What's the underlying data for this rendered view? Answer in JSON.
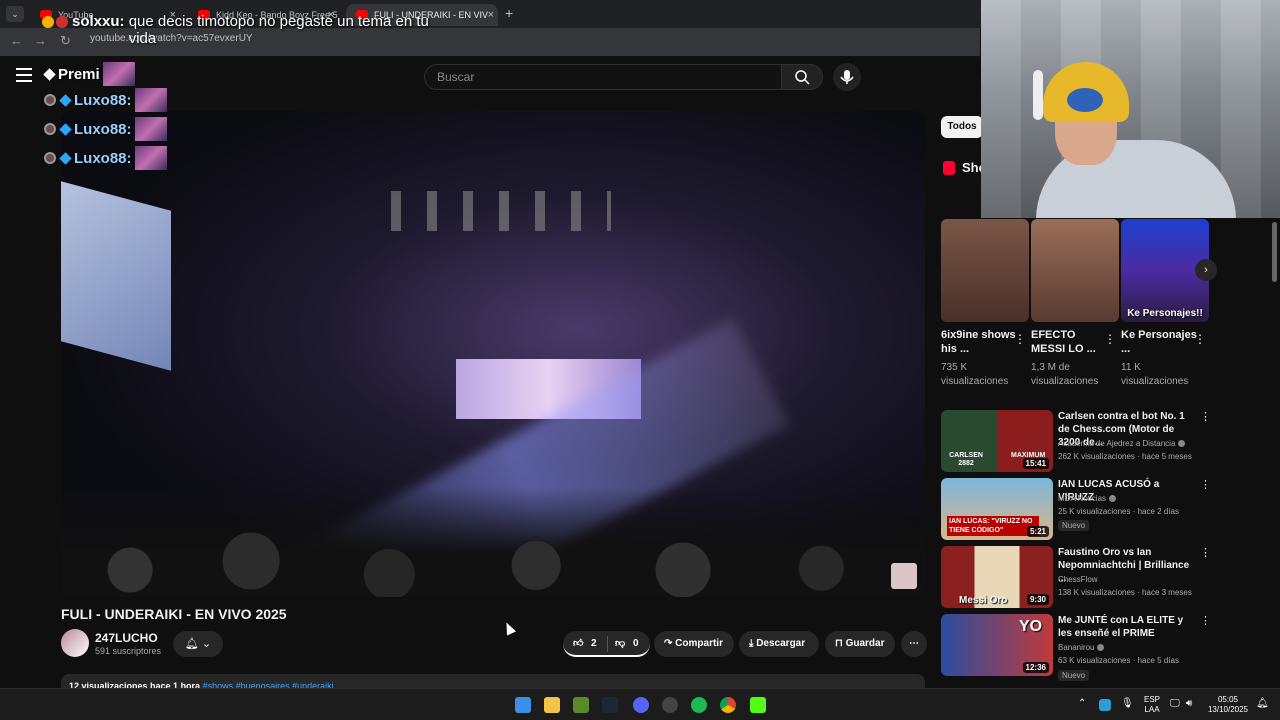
{
  "browser": {
    "tabs": [
      {
        "title": "YouTube"
      },
      {
        "title": "Kidd Keo - Bando Boyz Free 5 |"
      },
      {
        "title": "FULI - UNDERAIKI - EN VIV"
      }
    ],
    "url": "youtube.com/watch?v=ac57evxerUY"
  },
  "overlay_chat": {
    "user": "solxxu:",
    "message": "que decis timotopo no pegaste un tema en tu vida",
    "second_line": "Premi",
    "followers": [
      "Luxo88:",
      "Luxo88:",
      "Luxo88:"
    ]
  },
  "header": {
    "search_placeholder": "Buscar"
  },
  "video": {
    "title": "FULI - UNDERAIKI - EN VIVO 2025",
    "channel": "247LUCHO",
    "subscribers": "591 suscriptores",
    "likes": "2",
    "dislikes": "0",
    "share_label": "Compartir",
    "download_label": "Descargar",
    "save_label": "Guardar",
    "description_stats": "12 visualizaciones  hace 1 hora",
    "description_tags": "#shows #buenosaires #underaiki"
  },
  "sidebar": {
    "chip": "Todos",
    "shorts_label": "Sho",
    "shorts": [
      {
        "title": "6ix9ine shows his ...",
        "views": "735 K visualizaciones",
        "overlay": ""
      },
      {
        "title": "EFECTO MESSI LO ...",
        "views": "1,3 M de visualizaciones",
        "overlay": ""
      },
      {
        "title": "Ke Personajes ...",
        "views": "11 K visualizaciones",
        "overlay": "Ke Personajes!!"
      }
    ],
    "recommendations": [
      {
        "title": "Carlsen contra el bot No. 1 de Chess.com (Motor de 3200 de...",
        "channel": "Academia de Ajedrez a Distancia",
        "meta": "262 K visualizaciones · hace 5 meses",
        "duration": "15:41",
        "badge": "",
        "thumb_text_1": "CARLSEN",
        "thumb_text_2": "2882",
        "thumb_text_3": "MAXIMUM"
      },
      {
        "title": "IAN LUCAS ACUSÓ a VIRUZZ",
        "channel": "MDA Noticias",
        "meta": "25 K visualizaciones · hace 2 días",
        "duration": "5:21",
        "badge": "Nuevo",
        "thumb_text_1": "IAN LUCAS: \"VIRUZZ NO TIENE CÓDIGO\""
      },
      {
        "title": "Faustino Oro vs Ian Nepomniachtchi | Brilliance ...",
        "channel": "ChessFlow",
        "meta": "138 K visualizaciones · hace 3 meses",
        "duration": "9:30",
        "badge": "",
        "thumb_text_1": "Messi Oro"
      },
      {
        "title": "Me JUNTÉ con LA ELITE y les enseñé el PRIME",
        "channel": "Bananirou",
        "meta": "63 K visualizaciones · hace 5 días",
        "duration": "12:36",
        "badge": "Nuevo",
        "thumb_text_1": "YO"
      }
    ]
  },
  "taskbar": {
    "language": "ESP",
    "layout": "LAA",
    "time": "05:05",
    "date": "13/10/2025"
  },
  "colors": {
    "background": "#0f0f0f",
    "youtube_red": "#ff0000",
    "link_blue": "#3ea6ff"
  }
}
